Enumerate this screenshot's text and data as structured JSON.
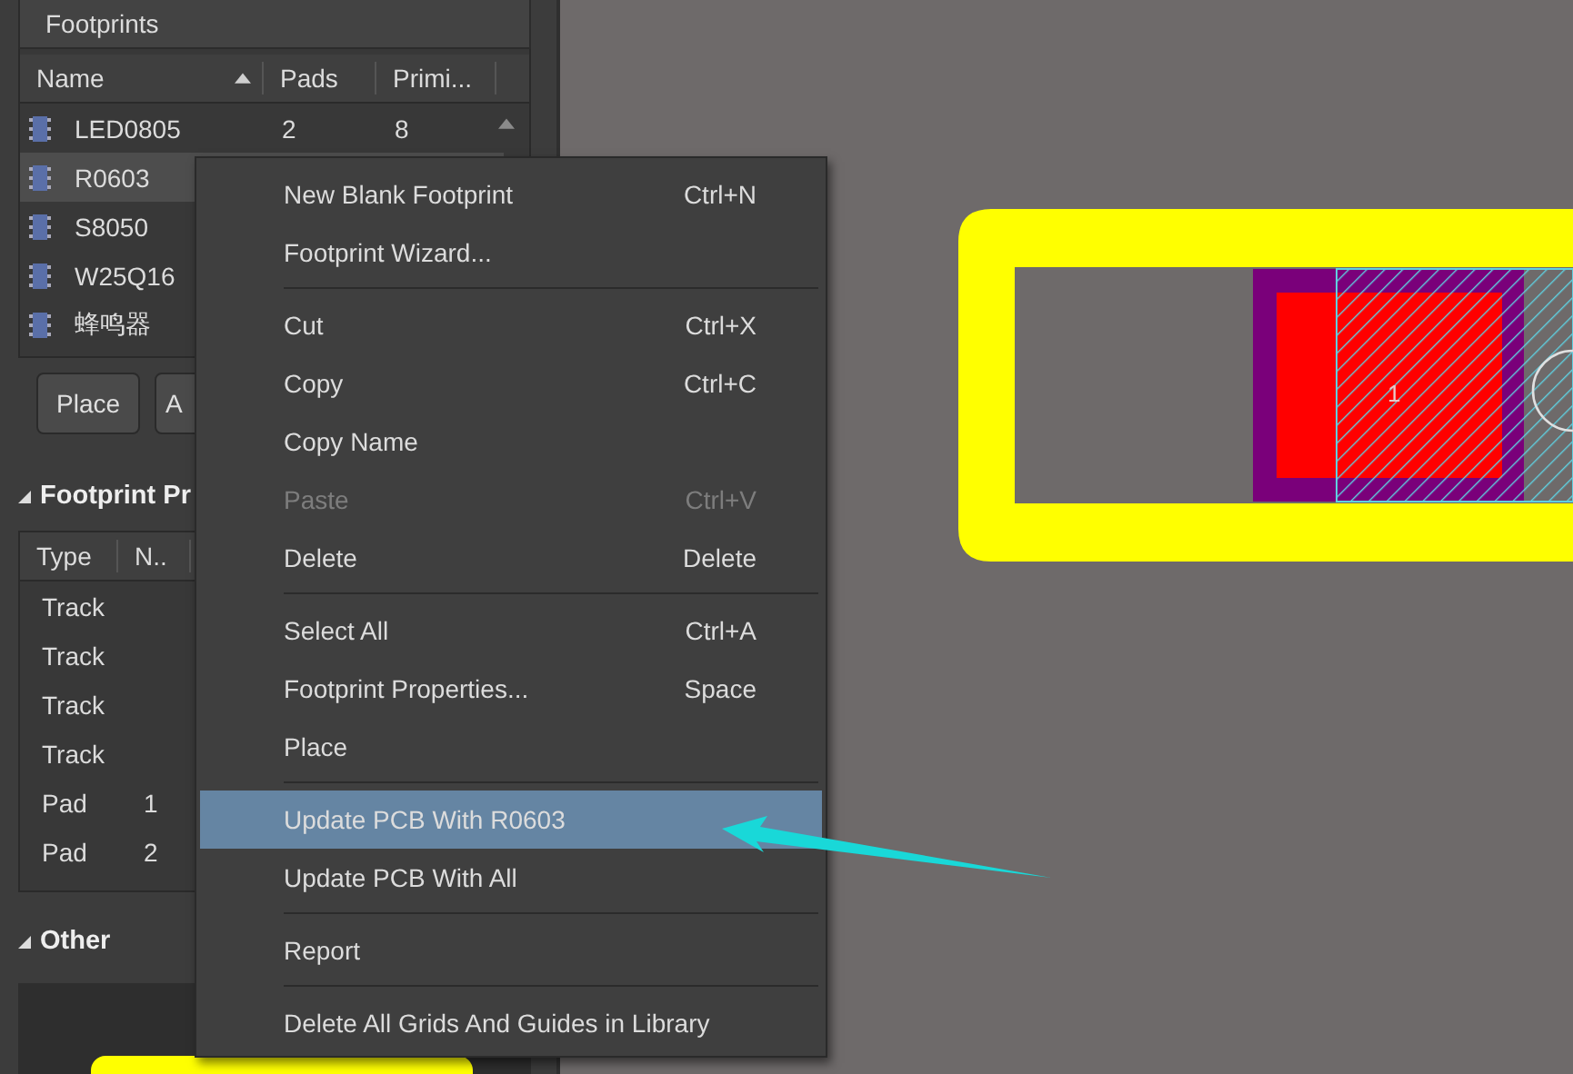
{
  "footprints_panel": {
    "title": "Footprints",
    "columns": [
      "Name",
      "Pads",
      "Primi..."
    ],
    "rows": [
      {
        "name": "LED0805",
        "pads": "2",
        "primitives": "8",
        "selected": false
      },
      {
        "name": "R0603",
        "selected": true
      },
      {
        "name": "S8050",
        "selected": false
      },
      {
        "name": "W25Q16",
        "selected": false
      },
      {
        "name": "蜂鸣器",
        "selected": false
      }
    ],
    "buttons": [
      "Place",
      "A"
    ]
  },
  "primitives_section": {
    "title": "Footprint Pr",
    "columns": [
      "Type",
      "N.."
    ],
    "rows": [
      {
        "type": "Track"
      },
      {
        "type": "Track"
      },
      {
        "type": "Track"
      },
      {
        "type": "Track"
      },
      {
        "type": "Pad",
        "number": "1"
      },
      {
        "type": "Pad",
        "number": "2"
      }
    ]
  },
  "other_section": {
    "title": "Other"
  },
  "canvas": {
    "pad_label": "1"
  },
  "context_menu": [
    {
      "kind": "item",
      "label": "New Blank Footprint",
      "shortcut": "Ctrl+N",
      "disabled": false,
      "selected": false
    },
    {
      "kind": "item",
      "label": "Footprint Wizard...",
      "disabled": false,
      "selected": false
    },
    {
      "kind": "separator"
    },
    {
      "kind": "item",
      "label": "Cut",
      "shortcut": "Ctrl+X",
      "disabled": false,
      "selected": false
    },
    {
      "kind": "item",
      "label": "Copy",
      "shortcut": "Ctrl+C",
      "disabled": false,
      "selected": false
    },
    {
      "kind": "item",
      "label": "Copy Name",
      "disabled": false,
      "selected": false
    },
    {
      "kind": "item",
      "label": "Paste",
      "shortcut": "Ctrl+V",
      "disabled": true,
      "selected": false
    },
    {
      "kind": "item",
      "label": "Delete",
      "shortcut": "Delete",
      "disabled": false,
      "selected": false
    },
    {
      "kind": "separator"
    },
    {
      "kind": "item",
      "label": "Select All",
      "shortcut": "Ctrl+A",
      "disabled": false,
      "selected": false
    },
    {
      "kind": "item",
      "label": "Footprint Properties...",
      "shortcut": "Space",
      "disabled": false,
      "selected": false
    },
    {
      "kind": "item",
      "label": "Place",
      "disabled": false,
      "selected": false
    },
    {
      "kind": "separator"
    },
    {
      "kind": "item",
      "label": "Update PCB With R0603",
      "disabled": false,
      "selected": true
    },
    {
      "kind": "item",
      "label": "Update PCB With All",
      "disabled": false,
      "selected": false
    },
    {
      "kind": "separator"
    },
    {
      "kind": "item",
      "label": "Report",
      "disabled": false,
      "selected": false
    },
    {
      "kind": "separator"
    },
    {
      "kind": "item",
      "label": "Delete All Grids And Guides in Library",
      "disabled": false,
      "selected": false
    }
  ]
}
